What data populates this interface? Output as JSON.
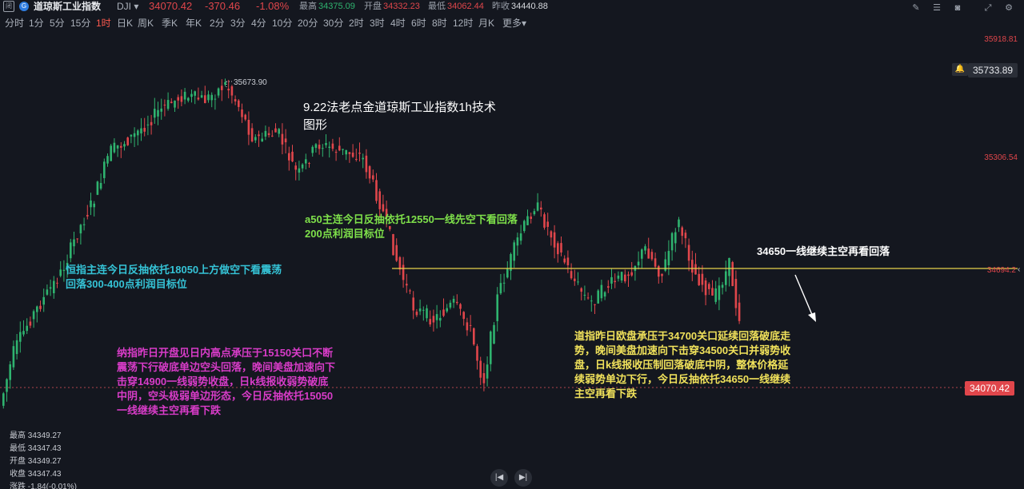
{
  "header": {
    "app_icon": "window-icon",
    "symbol_name": "道琼斯工业指数",
    "symbol_code": "DJI",
    "last_price": "34070.42",
    "change": "-370.46",
    "change_pct": "-1.08%",
    "high_label": "最高",
    "high_value": "34375.09",
    "open_label": "开盘",
    "open_value": "34332.23",
    "low_label": "最低",
    "low_value": "34062.44",
    "prev_close_label": "昨收",
    "prev_close_value": "34440.88"
  },
  "timeframes": [
    "分时",
    "1分",
    "5分",
    "15分",
    "1时",
    "日K",
    "周K",
    "季K",
    "年K",
    "2分",
    "3分",
    "4分",
    "10分",
    "20分",
    "30分",
    "2时",
    "3时",
    "4时",
    "6时",
    "8时",
    "12时",
    "月K",
    "更多"
  ],
  "active_timeframe": "1时",
  "tools": [
    "draw-icon",
    "layers-icon",
    "camera-icon",
    "expand-icon",
    "settings-icon"
  ],
  "price_axis": {
    "top": "35918.81",
    "upper": "35306.54",
    "mid": "34694.2",
    "alert_value": "35733.89",
    "current_value": "34070.42"
  },
  "peak_label": "35673.90",
  "annotations": {
    "title": "9.22法老点金道琼斯工业指数1h技术\n图形",
    "a50": "a50主连今日反抽依托12550一线先空下看回落\n200点利润目标位",
    "hengzhi": "恒指主连今日反抽依托18050上方做空下看震荡\n回落300-400点利润目标位",
    "nazhi": "纳指昨日开盘见日内高点承压于15150关口不断\n震荡下行破底单边空头回落，晚间美盘加速向下\n击穿14900一线弱势收盘，日k线报收弱势破底\n中阴，空头极弱单边形态，今日反抽依托15050\n一线继续主空再看下跌",
    "line_note": "34650一线继续主空再看回落",
    "daozhi": "道指昨日欧盘承压于34700关口延续回落破底走\n势，晚间美盘加速向下击穿34500关口并弱势收\n盘，日k线报收压制回落破底中阴，整体价格延\n续弱势单边下行，今日反抽依托34650一线继续\n主空再看下跌"
  },
  "ohlc_box": {
    "high_label": "最高",
    "high_value": "34349.27",
    "low_label": "最低",
    "low_value": "34347.43",
    "open_label": "开盘",
    "open_value": "34349.27",
    "close_label": "收盘",
    "close_value": "34347.43",
    "chg_label": "涨跌",
    "chg_value": "-1.84(-0.01%)"
  },
  "colors": {
    "up": "#2fb36f",
    "down": "#e0464b",
    "hline": "#e8d24a",
    "title_anno": "#ffffff",
    "a50_anno": "#7ee04a",
    "hengzhi_anno": "#35c3d6",
    "nazhi_anno": "#d83cc8",
    "daozhi_anno": "#f1e25b"
  }
}
